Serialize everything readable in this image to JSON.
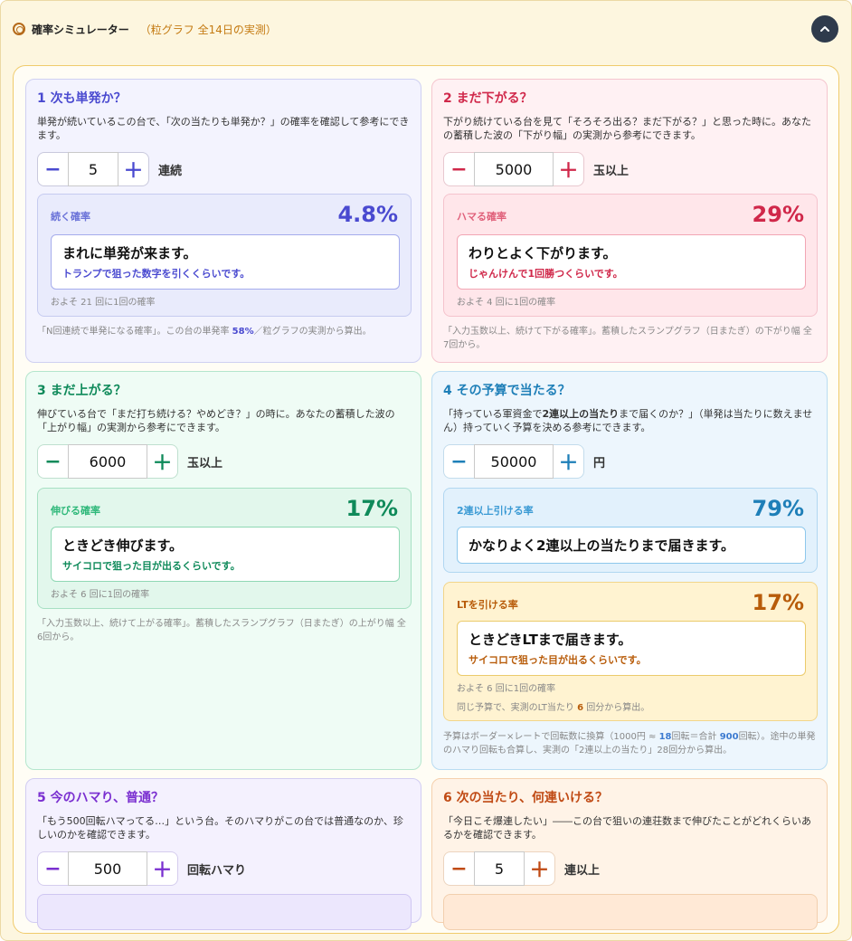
{
  "header": {
    "title": "確率シミュレーター",
    "subtitle": "（粒グラフ 全14日の実測）"
  },
  "colors": {
    "c1": "#4a4ad0",
    "c2": "#d0284a",
    "c3": "#0f8a5a",
    "c4": "#1e7fb8",
    "c5": "#7a2fd0",
    "c6": "#c04a14",
    "lt": "#b85c0a"
  },
  "icons": {
    "header": "target-icon",
    "collapse": "chevron-up-icon"
  },
  "card1": {
    "title": "1 次も単発か？",
    "desc": "単発が続いているこの台で、「次の当たりも単発か？」の確率を確認して参考にできます。",
    "minus": "−",
    "plus": "＋",
    "value": "5",
    "unit": "連続",
    "result_label": "続く確率",
    "result_value": "4.8%",
    "msg_main": "まれに単発が来ます。",
    "msg_sub": "トランプで狙った数字を引くくらいです。",
    "freq": "およそ 21 回に1回の確率",
    "note_a": "「N回連続で単発になる確率」。この台の単発率 ",
    "note_b": "58%",
    "note_c": "／粒グラフの実測から算出。"
  },
  "card2": {
    "title": "2 まだ下がる？",
    "desc": "下がり続けている台を見て「そろそろ出る？まだ下がる？」と思った時に。あなたの蓄積した波の「下がり幅」の実測から参考にできます。",
    "minus": "−",
    "plus": "＋",
    "value": "5000",
    "unit": "玉以上",
    "result_label": "ハマる確率",
    "result_value": "29%",
    "msg_main": "わりとよく下がります。",
    "msg_sub": "じゃんけんで1回勝つくらいです。",
    "freq": "およそ 4 回に1回の確率",
    "note": "「入力玉数以上、続けて下がる確率」。蓄積したスランプグラフ（日またぎ）の下がり幅 全7回から。"
  },
  "card3": {
    "title": "3 まだ上がる？",
    "desc": "伸びている台で「まだ打ち続ける？やめどき？」の時に。あなたの蓄積した波の「上がり幅」の実測から参考にできます。",
    "minus": "−",
    "plus": "＋",
    "value": "6000",
    "unit": "玉以上",
    "result_label": "伸びる確率",
    "result_value": "17%",
    "msg_main": "ときどき伸びます。",
    "msg_sub": "サイコロで狙った目が出るくらいです。",
    "freq": "およそ 6 回に1回の確率",
    "note": "「入力玉数以上、続けて上がる確率」。蓄積したスランプグラフ（日またぎ）の上がり幅 全6回から。"
  },
  "card4": {
    "title": "4 その予算で当たる？",
    "desc": "「持っている軍資金で2連以上の当たりまで届くのか？」（単発は当たりに数えません）持っていく予算を決める参考にできます。",
    "desc_a": "「持っている軍資金で",
    "desc_b": "2連以上の当たり",
    "desc_c": "まで届くのか？」（単発は当たりに数えません）持っていく予算を決める参考にできます。",
    "minus": "−",
    "plus": "＋",
    "value": "50000",
    "unit": "円",
    "r1_label": "2連以上引ける率",
    "r1_value": "79%",
    "r1_msg": "かなりよく2連以上の当たりまで届きます。",
    "r2_label": "LTを引ける率",
    "r2_value": "17%",
    "r2_msg_main": "ときどきLTまで届きます。",
    "r2_msg_sub": "サイコロで狙った目が出るくらいです。",
    "r2_freq": "およそ 6 回に1回の確率",
    "r2_extra_a": "同じ予算で、実測のLT当たり ",
    "r2_extra_b": "6",
    "r2_extra_c": " 回分から算出。",
    "note_a": "予算はボーダー×レートで回転数に換算（1000円 ≈ ",
    "note_b": "18",
    "note_c": "回転＝合計 ",
    "note_d": "900",
    "note_e": "回転）。途中の単発のハマり回転も合算し、実測の「2連以上の当たり」28回分から算出。"
  },
  "card5": {
    "title": "5 今のハマり、普通？",
    "desc": "「もう500回転ハマってる…」という台。そのハマりがこの台では普通なのか、珍しいのかを確認できます。",
    "minus": "−",
    "plus": "＋",
    "value": "500",
    "unit": "回転ハマり"
  },
  "card6": {
    "title": "6 次の当たり、何連いける？",
    "desc": "「今日こそ爆連したい」――この台で狙いの連荘数まで伸びたことがどれくらいあるかを確認できます。",
    "minus": "−",
    "plus": "＋",
    "value": "5",
    "unit": "連以上"
  }
}
